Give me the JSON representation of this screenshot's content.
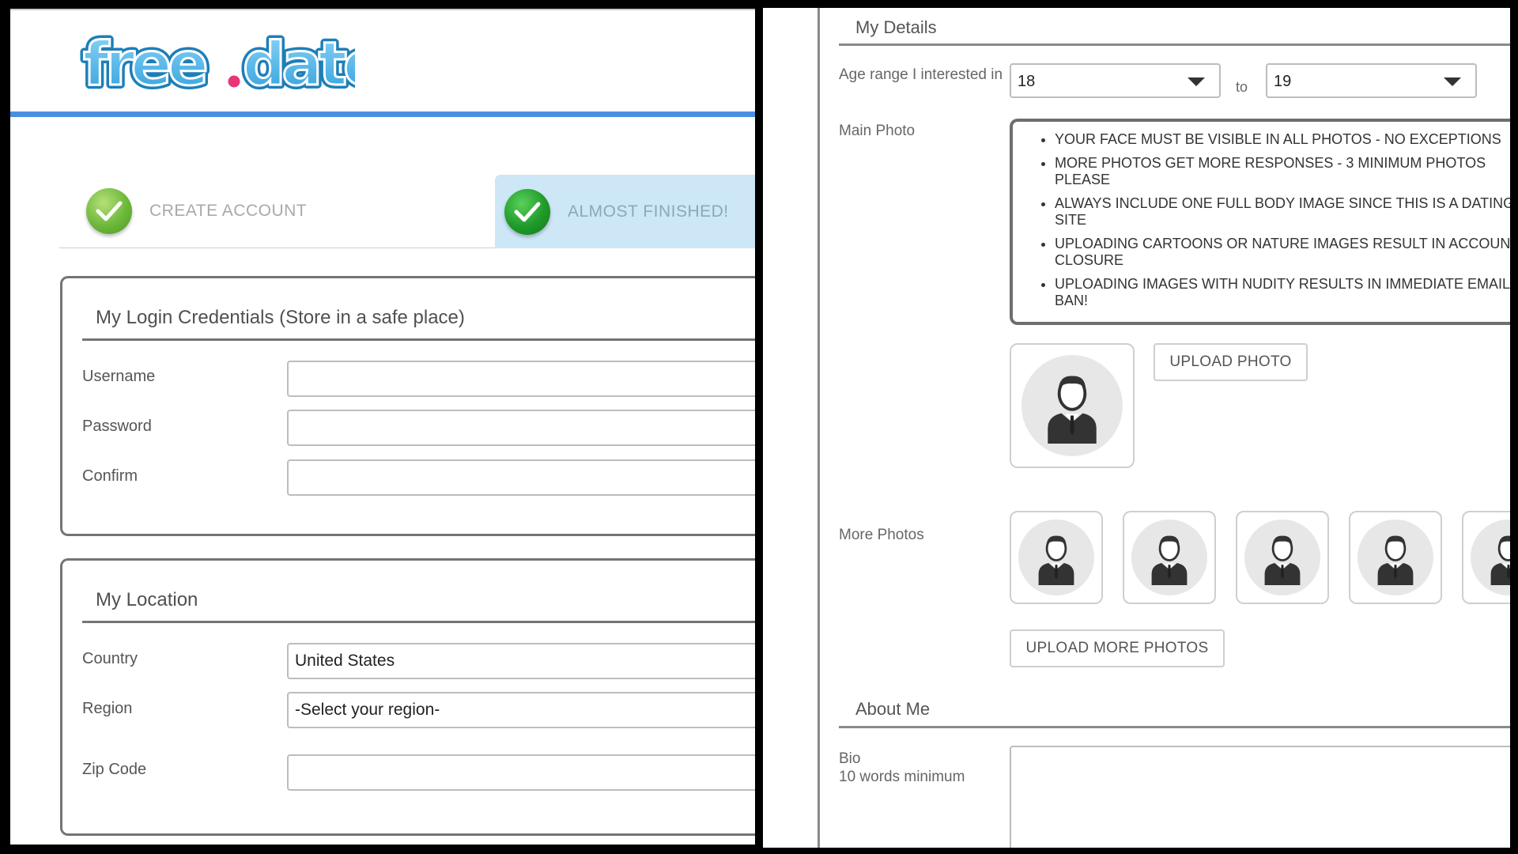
{
  "logo": {
    "text": "free.date"
  },
  "steps": [
    {
      "label": "CREATE ACCOUNT",
      "done": true
    },
    {
      "label": "ALMOST FINISHED!",
      "done": true,
      "active": true
    }
  ],
  "login": {
    "title": "My Login Credentials   (Store in a safe place)",
    "username_label": "Username",
    "password_label": "Password",
    "confirm_label": "Confirm",
    "username_value": "",
    "password_value": "",
    "confirm_value": ""
  },
  "location": {
    "title": "My Location",
    "country_label": "Country",
    "country_value": "United States",
    "region_label": "Region",
    "region_value": "-Select your region-",
    "zip_label": "Zip Code",
    "zip_value": ""
  },
  "details": {
    "title": "My Details",
    "age_label": "Age range I interested in",
    "age_from": "18",
    "age_to_label": "to",
    "age_to": "19",
    "main_photo_label": "Main Photo",
    "rules": [
      "YOUR FACE MUST BE VISIBLE IN ALL PHOTOS - NO EXCEPTIONS",
      "MORE PHOTOS GET MORE RESPONSES - 3 MINIMUM PHOTOS PLEASE",
      "ALWAYS INCLUDE ONE FULL BODY IMAGE SINCE THIS IS A DATING SITE",
      "UPLOADING CARTOONS OR NATURE IMAGES RESULT IN ACCOUNT CLOSURE",
      "UPLOADING IMAGES WITH NUDITY RESULTS IN IMMEDIATE EMAIL BAN!"
    ],
    "upload_photo_label": "UPLOAD PHOTO",
    "more_photos_label": "More Photos",
    "upload_more_label": "UPLOAD MORE PHOTOS"
  },
  "about": {
    "title": "About Me",
    "bio_label": "Bio",
    "bio_hint": "10 words minimum",
    "bio_value": ""
  },
  "colors": {
    "accent_blue": "#4a90e2",
    "step_active_bg": "#cde7f7",
    "check_green": "#1f9a2a",
    "border_gray": "#747474"
  }
}
